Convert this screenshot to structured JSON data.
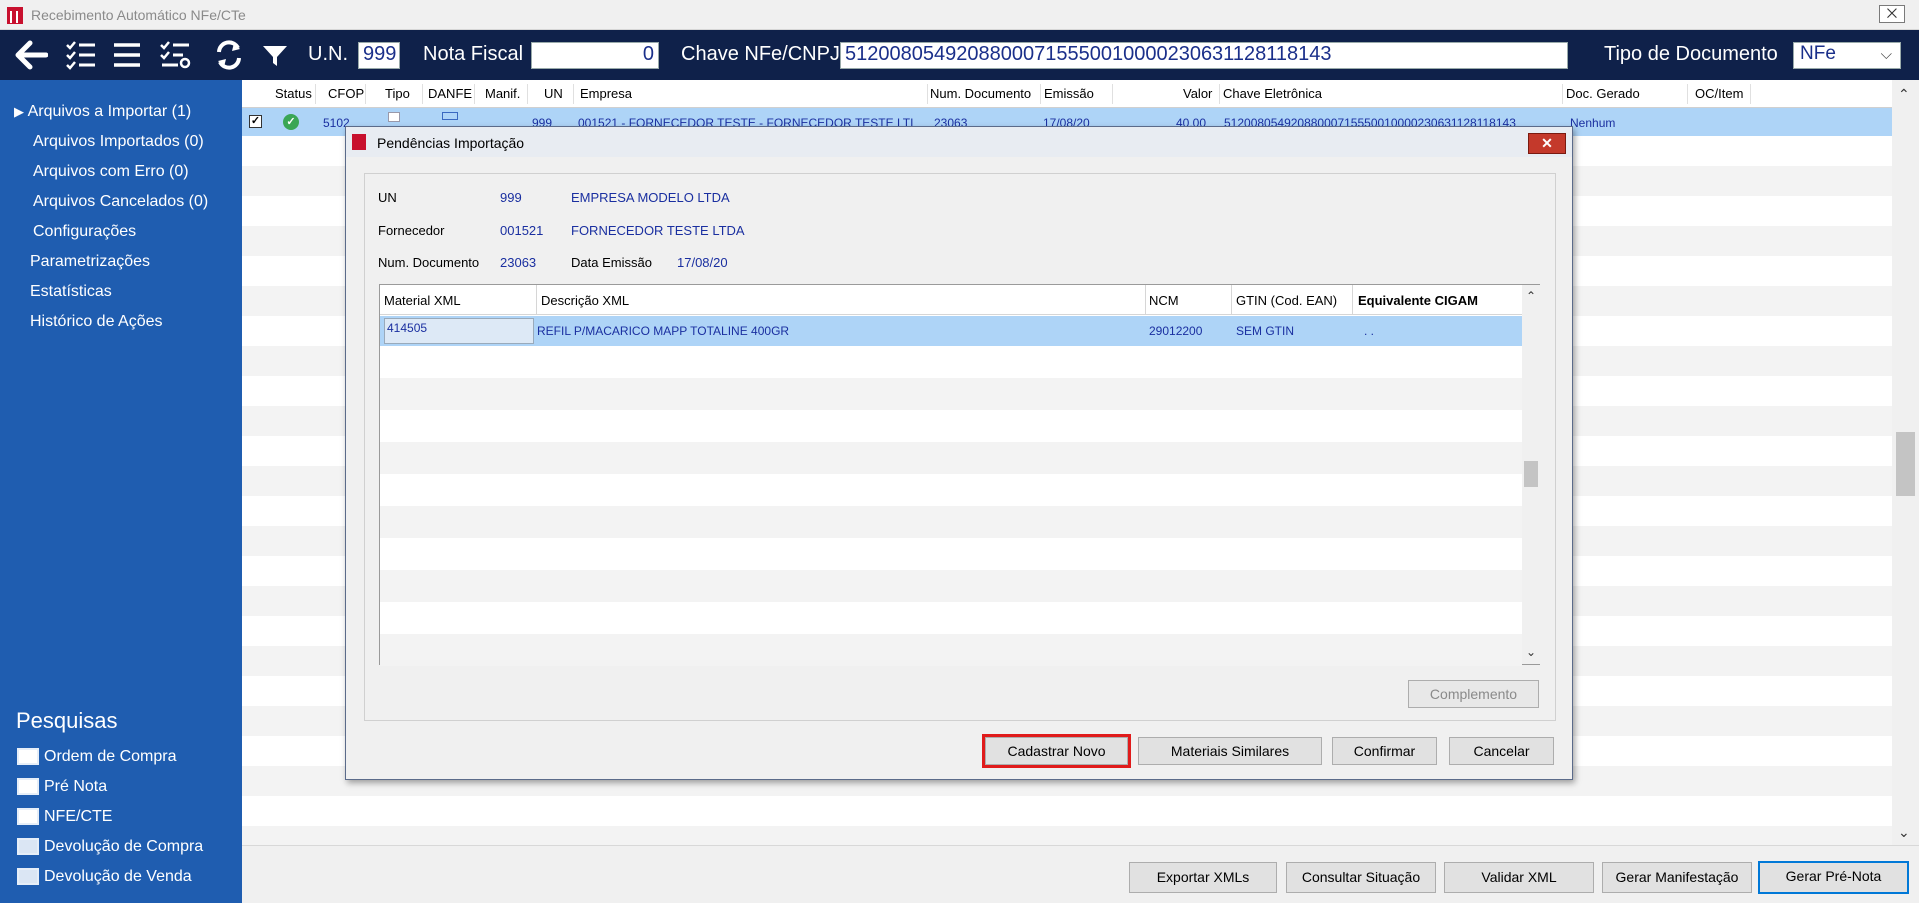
{
  "window": {
    "title": "Recebimento Automático NFe/CTe",
    "close_glyph": "⨉"
  },
  "toolbar": {
    "icons": [
      "back-arrow-icon",
      "checklist-icon",
      "menu-icon",
      "filter-list-icon",
      "refresh-icon",
      "filter-icon"
    ],
    "un_label": "U.N.",
    "un_value": "999",
    "nota_label": "Nota Fiscal",
    "nota_value": "0",
    "chave_label": "Chave NFe/CNPJ",
    "chave_value": "51200805492088000715550010000230631128118143",
    "tipo_label": "Tipo de Documento",
    "tipo_value": "NFe"
  },
  "sidebar": {
    "items": [
      {
        "label": "Arquivos a Importar (1)",
        "arrow": "▶"
      },
      {
        "label": "Arquivos Importados (0)"
      },
      {
        "label": "Arquivos com Erro (0)"
      },
      {
        "label": "Arquivos Cancelados (0)"
      },
      {
        "label": "Configurações"
      },
      {
        "label": "Parametrizações"
      },
      {
        "label": "Estatísticas"
      },
      {
        "label": "Histórico de Ações"
      }
    ],
    "pesquisas_title": "Pesquisas",
    "pesquisas": [
      {
        "label": "Ordem de Compra"
      },
      {
        "label": "Pré Nota"
      },
      {
        "label": "NFE/CTE"
      },
      {
        "label": "Devolução de Compra"
      },
      {
        "label": "Devolução de Venda"
      }
    ]
  },
  "grid": {
    "columns": [
      "Status",
      "CFOP",
      "Tipo",
      "DANFE",
      "Manif.",
      "UN",
      "Empresa",
      "Num. Documento",
      "Emissão",
      "Valor",
      "Chave Eletrônica",
      "Doc. Gerado",
      "OC/Item"
    ],
    "row": {
      "checked": "✓",
      "status_glyph": "✓",
      "cfop": "5102",
      "un": "999",
      "empresa": "001521 - FORNECEDOR TESTE - FORNECEDOR TESTE LTI",
      "num_doc": "23063",
      "emissao": "17/08/20",
      "valor": "40,00",
      "chave": "51200805492088000715550010000230631128118143",
      "doc_gerado": "Nenhum"
    }
  },
  "bottom_buttons": [
    "Exportar XMLs",
    "Consultar Situação",
    "Validar XML",
    "Gerar Manifestação",
    "Gerar Pré-Nota"
  ],
  "dialog": {
    "title": "Pendências Importação",
    "close_glyph": "✕",
    "info": {
      "un_label": "UN",
      "un_code": "999",
      "un_name": "EMPRESA MODELO LTDA",
      "fornecedor_label": "Fornecedor",
      "fornecedor_code": "001521",
      "fornecedor_name": "FORNECEDOR TESTE  LTDA",
      "num_doc_label": "Num. Documento",
      "num_doc_value": "23063",
      "data_emissao_label": "Data Emissão",
      "data_emissao_value": "17/08/20"
    },
    "grid": {
      "columns": [
        "Material XML",
        "Descrição XML",
        "NCM",
        "GTIN (Cod. EAN)",
        "Equivalente CIGAM"
      ],
      "row": {
        "material": "414505",
        "descricao": "REFIL P/MACARICO MAPP TOTALINE 400GR",
        "ncm": "29012200",
        "gtin": "SEM GTIN",
        "equivalente": ". ."
      }
    },
    "complemento_label": "Complemento",
    "buttons": [
      "Cadastrar Novo",
      "Materiais Similares",
      "Confirmar",
      "Cancelar"
    ]
  }
}
